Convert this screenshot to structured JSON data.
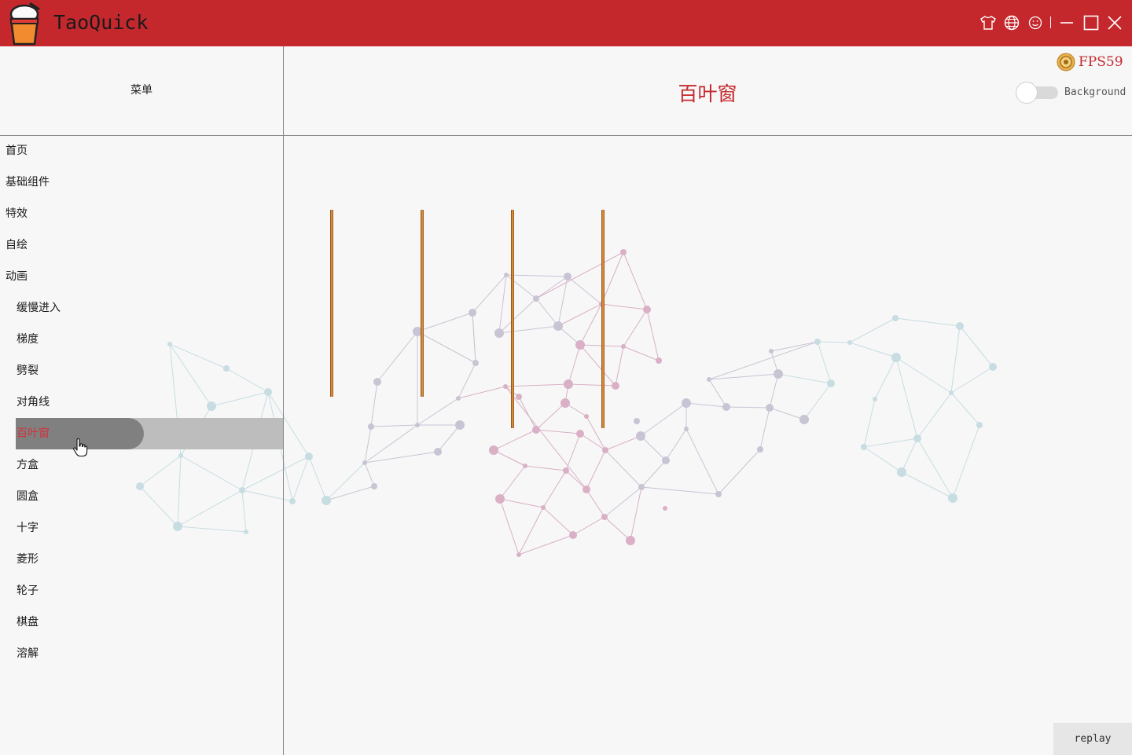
{
  "app": {
    "title": "TaoQuick"
  },
  "titlebar": {
    "buttons": [
      {
        "name": "skin-button",
        "icon": "shirt-icon"
      },
      {
        "name": "language-button",
        "icon": "globe-icon"
      },
      {
        "name": "about-button",
        "icon": "smiley-icon"
      },
      {
        "name": "minimize-button",
        "icon": "minimize-icon"
      },
      {
        "name": "maximize-button",
        "icon": "maximize-icon"
      },
      {
        "name": "close-button",
        "icon": "close-icon"
      }
    ]
  },
  "menu": {
    "title": "菜单",
    "items": [
      {
        "label": "首页",
        "level": 1,
        "active": false
      },
      {
        "label": "基础组件",
        "level": 1,
        "active": false
      },
      {
        "label": "特效",
        "level": 1,
        "active": false
      },
      {
        "label": "自绘",
        "level": 1,
        "active": false
      },
      {
        "label": "动画",
        "level": 1,
        "active": false
      },
      {
        "label": "缓慢进入",
        "level": 2,
        "active": false
      },
      {
        "label": "梯度",
        "level": 2,
        "active": false
      },
      {
        "label": "劈裂",
        "level": 2,
        "active": false
      },
      {
        "label": "对角线",
        "level": 2,
        "active": false
      },
      {
        "label": "百叶窗",
        "level": 2,
        "active": true
      },
      {
        "label": "方盒",
        "level": 2,
        "active": false
      },
      {
        "label": "圆盒",
        "level": 2,
        "active": false
      },
      {
        "label": "十字",
        "level": 2,
        "active": false
      },
      {
        "label": "菱形",
        "level": 2,
        "active": false
      },
      {
        "label": "轮子",
        "level": 2,
        "active": false
      },
      {
        "label": "棋盘",
        "level": 2,
        "active": false
      },
      {
        "label": "溶解",
        "level": 2,
        "active": false
      }
    ]
  },
  "content": {
    "page_title": "百叶窗",
    "fps_label": "FPS59",
    "background_toggle": {
      "label": "Background",
      "on": false
    },
    "replay_label": "replay"
  },
  "colors": {
    "accent": "#c4282d",
    "menu_active_bg": "#bdbdbd",
    "menu_active_text": "#d2323a"
  }
}
